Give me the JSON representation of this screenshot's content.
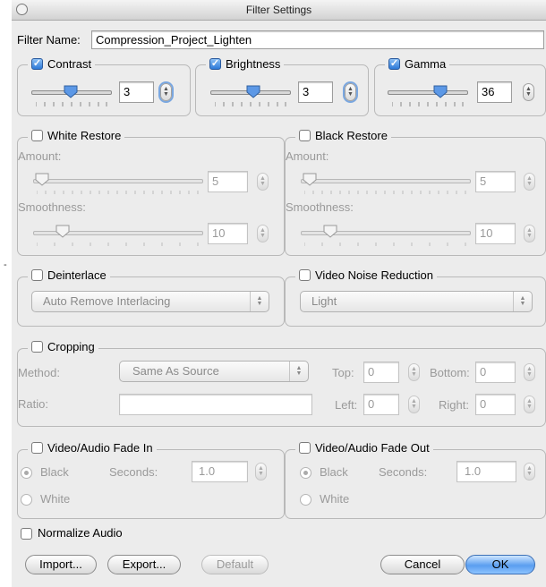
{
  "window": {
    "title": "Filter Settings"
  },
  "filter_name": {
    "label": "Filter Name:",
    "value": "Compression_Project_Lighten"
  },
  "contrast": {
    "label": "Contrast",
    "checked": true,
    "value": "3",
    "level": 0.5
  },
  "brightness": {
    "label": "Brightness",
    "checked": true,
    "value": "3",
    "level": 0.55
  },
  "gamma": {
    "label": "Gamma",
    "checked": true,
    "value": "36",
    "level": 0.7
  },
  "white_restore": {
    "label": "White Restore",
    "checked": false,
    "amount_label": "Amount:",
    "amount": "5",
    "amount_level": 0.02,
    "smooth_label": "Smoothness:",
    "smooth": "10",
    "smooth_level": 0.15
  },
  "black_restore": {
    "label": "Black Restore",
    "checked": false,
    "amount_label": "Amount:",
    "amount": "5",
    "amount_level": 0.02,
    "smooth_label": "Smoothness:",
    "smooth": "10",
    "smooth_level": 0.15
  },
  "deinterlace": {
    "label": "Deinterlace",
    "checked": false,
    "option": "Auto Remove Interlacing"
  },
  "noise": {
    "label": "Video Noise Reduction",
    "checked": false,
    "option": "Light"
  },
  "cropping": {
    "label": "Cropping",
    "checked": false,
    "method_label": "Method:",
    "method": "Same As Source",
    "ratio_label": "Ratio:",
    "top_label": "Top:",
    "top": "0",
    "bottom_label": "Bottom:",
    "bottom": "0",
    "left_label": "Left:",
    "left": "0",
    "right_label": "Right:",
    "right": "0"
  },
  "fade_in": {
    "label": "Video/Audio Fade In",
    "checked": false,
    "black": "Black",
    "white": "White",
    "seconds_label": "Seconds:",
    "seconds": "1.0"
  },
  "fade_out": {
    "label": "Video/Audio Fade Out",
    "checked": false,
    "black": "Black",
    "white": "White",
    "seconds_label": "Seconds:",
    "seconds": "1.0"
  },
  "normalize": {
    "label": "Normalize Audio",
    "checked": false
  },
  "buttons": {
    "import": "Import...",
    "export": "Export...",
    "default": "Default",
    "cancel": "Cancel",
    "ok": "OK"
  },
  "margin_mark": "-"
}
